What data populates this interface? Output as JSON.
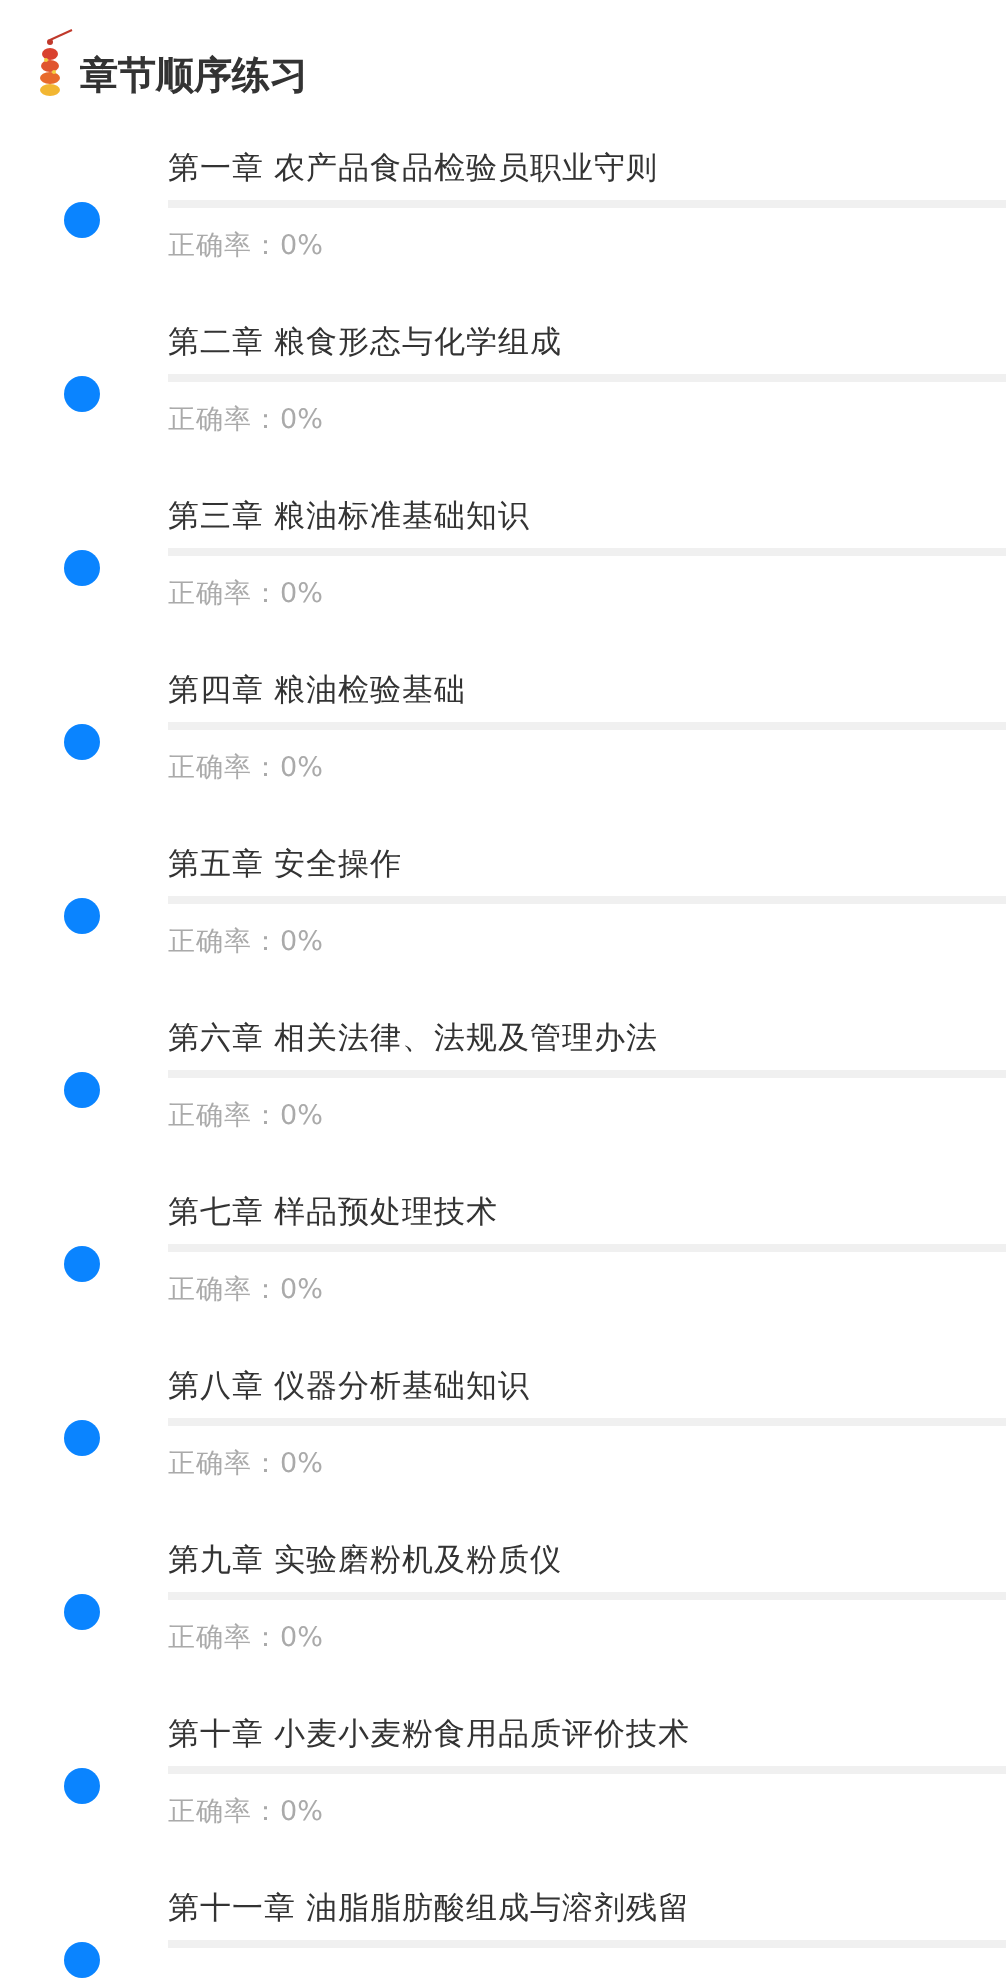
{
  "header": {
    "title": "章节顺序练习"
  },
  "chapters": [
    {
      "title": "第一章 农产品食品检验员职业守则",
      "accuracy": "正确率：0%"
    },
    {
      "title": "第二章 粮食形态与化学组成",
      "accuracy": "正确率：0%"
    },
    {
      "title": "第三章 粮油标准基础知识",
      "accuracy": "正确率：0%"
    },
    {
      "title": "第四章 粮油检验基础",
      "accuracy": "正确率：0%"
    },
    {
      "title": "第五章 安全操作",
      "accuracy": "正确率：0%"
    },
    {
      "title": "第六章 相关法律、法规及管理办法",
      "accuracy": "正确率：0%"
    },
    {
      "title": "第七章 样品预处理技术",
      "accuracy": "正确率：0%"
    },
    {
      "title": "第八章 仪器分析基础知识",
      "accuracy": "正确率：0%"
    },
    {
      "title": "第九章 实验磨粉机及粉质仪",
      "accuracy": "正确率：0%"
    },
    {
      "title": "第十章 小麦小麦粉食用品质评价技术",
      "accuracy": "正确率：0%"
    },
    {
      "title": "第十一章 油脂脂肪酸组成与溶剂残留"
    }
  ]
}
